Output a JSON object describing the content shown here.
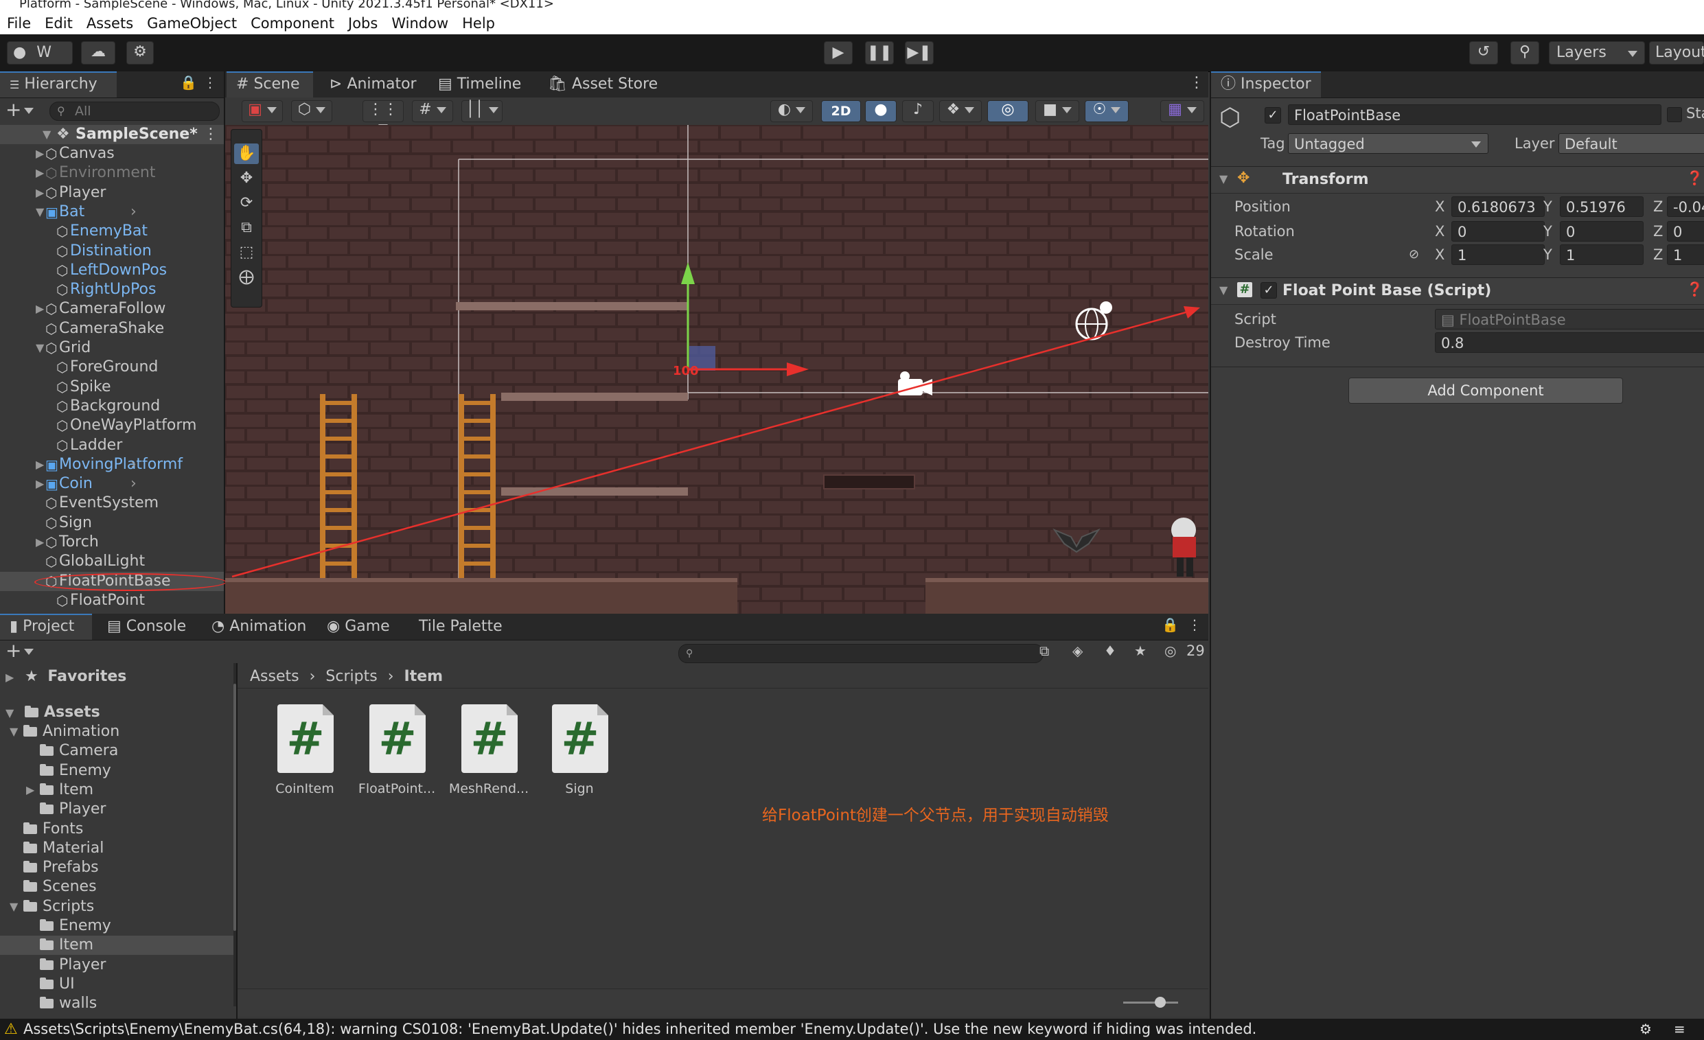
{
  "window": {
    "title": "Platform - SampleScene - Windows, Mac, Linux - Unity 2021.3.45f1 Personal* <DX11>"
  },
  "menu": [
    "File",
    "Edit",
    "Assets",
    "GameObject",
    "Component",
    "Jobs",
    "Window",
    "Help"
  ],
  "toolbar": {
    "account_label": "W",
    "layers_label": "Layers",
    "layout_label": "Layout"
  },
  "hierarchy": {
    "tab_label": "Hierarchy",
    "search_placeholder": "All",
    "scene_name": "SampleScene*",
    "items": [
      {
        "label": "Canvas"
      },
      {
        "label": "Environment"
      },
      {
        "label": "Player"
      },
      {
        "label": "Bat"
      },
      {
        "label": "EnemyBat"
      },
      {
        "label": "Distination"
      },
      {
        "label": "LeftDownPos"
      },
      {
        "label": "RightUpPos"
      },
      {
        "label": "CameraFollow"
      },
      {
        "label": "CameraShake"
      },
      {
        "label": "Grid"
      },
      {
        "label": "ForeGround"
      },
      {
        "label": "Spike"
      },
      {
        "label": "Background"
      },
      {
        "label": "OneWayPlatform"
      },
      {
        "label": "Ladder"
      },
      {
        "label": "MovingPlatformf"
      },
      {
        "label": "Coin"
      },
      {
        "label": "EventSystem"
      },
      {
        "label": "Sign"
      },
      {
        "label": "Torch"
      },
      {
        "label": "GlobalLight"
      },
      {
        "label": "FloatPointBase"
      },
      {
        "label": "FloatPoint"
      }
    ]
  },
  "scene_tabs": [
    "Scene",
    "Animator",
    "Timeline",
    "Asset Store"
  ],
  "scene_toolbar": {
    "mode_2d": "2D"
  },
  "scene_gizmo_label": "100",
  "inspector": {
    "tab_label": "Inspector",
    "object_name": "FloatPointBase",
    "static_label": "Sta",
    "tag_label": "Tag",
    "tag_value": "Untagged",
    "layer_label": "Layer",
    "layer_value": "Default",
    "transform": {
      "title": "Transform",
      "position_label": "Position",
      "rotation_label": "Rotation",
      "scale_label": "Scale",
      "position": {
        "x": "0.6180673",
        "y": "0.51976",
        "z": "-0.04"
      },
      "rotation": {
        "x": "0",
        "y": "0",
        "z": "0"
      },
      "scale": {
        "x": "1",
        "y": "1",
        "z": "1"
      }
    },
    "script_component": {
      "title": "Float Point Base (Script)",
      "script_label": "Script",
      "script_value": "FloatPointBase",
      "destroy_label": "Destroy Time",
      "destroy_value": "0.8"
    },
    "add_component": "Add Component"
  },
  "project": {
    "tabs": [
      "Project",
      "Console",
      "Animation",
      "Game",
      "Tile Palette"
    ],
    "visible_count": "29",
    "favorites_label": "Favorites",
    "assets_label": "Assets",
    "tree": [
      {
        "label": "Animation",
        "level": 1
      },
      {
        "label": "Camera",
        "level": 2
      },
      {
        "label": "Enemy",
        "level": 2
      },
      {
        "label": "Item",
        "level": 2
      },
      {
        "label": "Player",
        "level": 2
      },
      {
        "label": "Fonts",
        "level": 1
      },
      {
        "label": "Material",
        "level": 1
      },
      {
        "label": "Prefabs",
        "level": 1
      },
      {
        "label": "Scenes",
        "level": 1
      },
      {
        "label": "Scripts",
        "level": 1
      },
      {
        "label": "Enemy",
        "level": 2
      },
      {
        "label": "Item",
        "level": 2
      },
      {
        "label": "Player",
        "level": 2
      },
      {
        "label": "UI",
        "level": 2
      },
      {
        "label": "walls",
        "level": 2
      }
    ],
    "breadcrumb": [
      "Assets",
      "Scripts",
      "Item"
    ],
    "files": [
      {
        "name": "CoinItem"
      },
      {
        "name": "FloatPoint..."
      },
      {
        "name": "MeshRend..."
      },
      {
        "name": "Sign"
      }
    ],
    "annotation": "给FloatPoint创建一个父节点，用于实现自动销毁"
  },
  "status": {
    "message": "Assets\\Scripts\\Enemy\\EnemyBat.cs(64,18): warning CS0108: 'EnemyBat.Update()' hides inherited member 'Enemy.Update()'. Use the new keyword if hiding was intended."
  },
  "colors": {
    "accent": "#3a79bb",
    "prefab_blue": "#7cb7f2",
    "annotation": "#e8661f",
    "red_line": "#e8302c",
    "warning": "#f2c200"
  }
}
